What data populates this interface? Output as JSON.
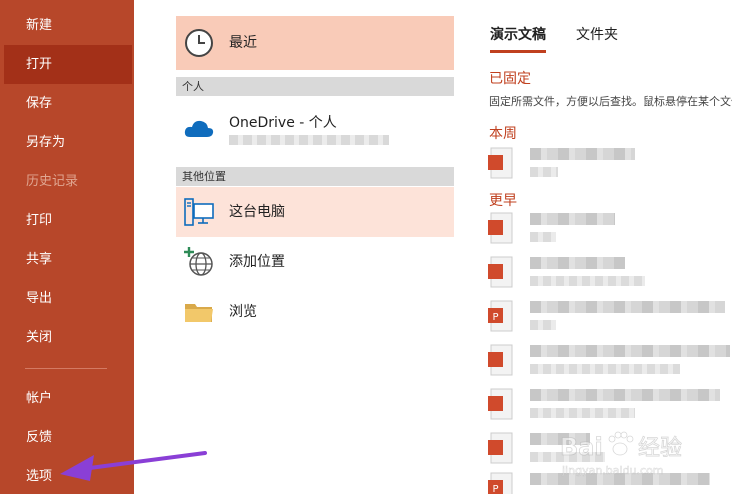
{
  "sidebar": {
    "items": [
      {
        "label": "新建"
      },
      {
        "label": "打开"
      },
      {
        "label": "保存"
      },
      {
        "label": "另存为"
      },
      {
        "label": "历史记录"
      },
      {
        "label": "打印"
      },
      {
        "label": "共享"
      },
      {
        "label": "导出"
      },
      {
        "label": "关闭"
      },
      {
        "label": "帐户"
      },
      {
        "label": "反馈"
      },
      {
        "label": "选项"
      }
    ],
    "selected": "打开",
    "disabled": "历史记录"
  },
  "locations": {
    "recent": {
      "label": "最近",
      "icon": "clock-icon"
    },
    "section_personal": "个人",
    "onedrive": {
      "label": "OneDrive - 个人",
      "icon": "cloud-icon"
    },
    "section_other": "其他位置",
    "this_pc": {
      "label": "这台电脑",
      "icon": "computer-icon"
    },
    "add_place": {
      "label": "添加位置",
      "icon": "add-globe-icon"
    },
    "browse": {
      "label": "浏览",
      "icon": "folder-icon"
    }
  },
  "recent_panel": {
    "tabs": [
      {
        "label": "演示文稿",
        "active": true
      },
      {
        "label": "文件夹",
        "active": false
      }
    ],
    "pinned": {
      "heading": "已固定",
      "description": "固定所需文件，方便以后查找。鼠标悬停在某个文件上时"
    },
    "this_week": {
      "heading": "本周"
    },
    "earlier": {
      "heading": "更早"
    }
  },
  "watermark": {
    "brand": "Bai",
    "suffix": "经验",
    "url": "jingyan.baidu.com"
  },
  "colors": {
    "sidebar": "#b7472a",
    "sidebar_selected": "#a33018",
    "accent": "#c0401f",
    "highlight": "#f9cbb8",
    "arrow": "#8a3fd6"
  }
}
